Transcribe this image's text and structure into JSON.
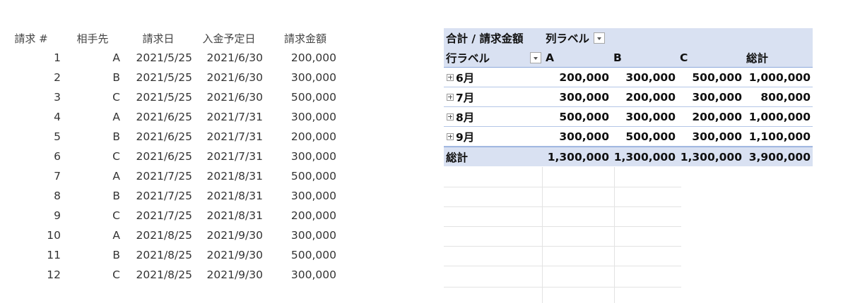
{
  "data_table": {
    "headers": {
      "no": "請求 #",
      "party": "相手先",
      "bill_date": "請求日",
      "due_date": "入金予定日",
      "amount": "請求金額"
    },
    "rows": [
      {
        "no": "1",
        "party": "A",
        "bill_date": "2021/5/25",
        "due_date": "2021/6/30",
        "amount": "200,000"
      },
      {
        "no": "2",
        "party": "B",
        "bill_date": "2021/5/25",
        "due_date": "2021/6/30",
        "amount": "300,000"
      },
      {
        "no": "3",
        "party": "C",
        "bill_date": "2021/5/25",
        "due_date": "2021/6/30",
        "amount": "500,000"
      },
      {
        "no": "4",
        "party": "A",
        "bill_date": "2021/6/25",
        "due_date": "2021/7/31",
        "amount": "300,000"
      },
      {
        "no": "5",
        "party": "B",
        "bill_date": "2021/6/25",
        "due_date": "2021/7/31",
        "amount": "200,000"
      },
      {
        "no": "6",
        "party": "C",
        "bill_date": "2021/6/25",
        "due_date": "2021/7/31",
        "amount": "300,000"
      },
      {
        "no": "7",
        "party": "A",
        "bill_date": "2021/7/25",
        "due_date": "2021/8/31",
        "amount": "500,000"
      },
      {
        "no": "8",
        "party": "B",
        "bill_date": "2021/7/25",
        "due_date": "2021/8/31",
        "amount": "300,000"
      },
      {
        "no": "9",
        "party": "C",
        "bill_date": "2021/7/25",
        "due_date": "2021/8/31",
        "amount": "200,000"
      },
      {
        "no": "10",
        "party": "A",
        "bill_date": "2021/8/25",
        "due_date": "2021/9/30",
        "amount": "300,000"
      },
      {
        "no": "11",
        "party": "B",
        "bill_date": "2021/8/25",
        "due_date": "2021/9/30",
        "amount": "500,000"
      },
      {
        "no": "12",
        "party": "C",
        "bill_date": "2021/8/25",
        "due_date": "2021/9/30",
        "amount": "300,000"
      }
    ]
  },
  "pivot": {
    "value_field": "合計 / 請求金額",
    "column_labels": "列ラベル",
    "row_labels": "行ラベル",
    "columns": [
      "A",
      "B",
      "C",
      "総計"
    ],
    "rows": [
      {
        "label": "6月",
        "values": [
          "200,000",
          "300,000",
          "500,000",
          "1,000,000"
        ]
      },
      {
        "label": "7月",
        "values": [
          "300,000",
          "200,000",
          "300,000",
          "800,000"
        ]
      },
      {
        "label": "8月",
        "values": [
          "500,000",
          "300,000",
          "200,000",
          "1,000,000"
        ]
      },
      {
        "label": "9月",
        "values": [
          "300,000",
          "500,000",
          "300,000",
          "1,100,000"
        ]
      }
    ],
    "total": {
      "label": "総計",
      "values": [
        "1,300,000",
        "1,300,000",
        "1,300,000",
        "3,900,000"
      ]
    },
    "icons": {
      "filter": "dropdown-filter-icon",
      "expand": "expand-plus-icon"
    },
    "colors": {
      "header_bg": "#d9e1f2",
      "border": "#8ea9db"
    }
  }
}
